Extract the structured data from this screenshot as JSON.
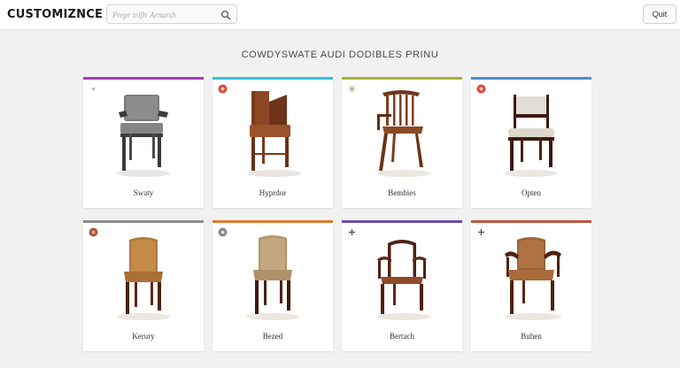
{
  "header": {
    "brand": "CUSTOMIZNCE",
    "search_placeholder": "Prepr triflr Arnarsh",
    "quit_label": "Quit"
  },
  "heading": "COWDYSWATE AUDI DODIBLES PRINU",
  "products": [
    {
      "label": "Swaty",
      "accent": "#a33fb4",
      "badge": "dot",
      "icon": "gray-upholstered-armchair-icon"
    },
    {
      "label": "Hyprdor",
      "accent": "#3bbfd8",
      "badge": "red",
      "icon": "wooden-slat-back-chair-icon"
    },
    {
      "label": "Bembies",
      "accent": "#a6b33a",
      "badge": "neutral",
      "icon": "windsor-spindle-armchair-icon"
    },
    {
      "label": "Opten",
      "accent": "#4f8fc6",
      "badge": "red",
      "icon": "cushioned-dining-chair-icon"
    },
    {
      "label": "Kerury",
      "accent": "#8d8d8d",
      "badge": "brown",
      "icon": "leather-parsons-chair-icon"
    },
    {
      "label": "Bezed",
      "accent": "#e07a2e",
      "badge": "gray",
      "icon": "upholstered-side-chair-icon"
    },
    {
      "label": "Bertach",
      "accent": "#6a4fb4",
      "badge": "plus",
      "icon": "open-arm-wood-chair-icon"
    },
    {
      "label": "Buhen",
      "accent": "#c4553e",
      "badge": "plus",
      "icon": "curved-arm-upholstered-chair-icon"
    }
  ]
}
